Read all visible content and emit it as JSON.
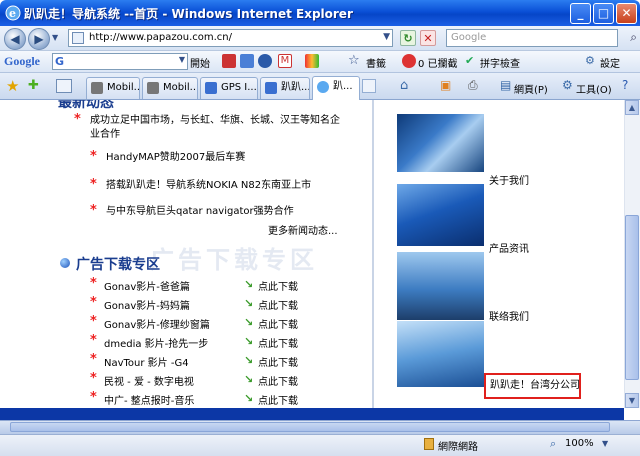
{
  "window": {
    "title": "趴趴走！导航系统 --首页 - Windows Internet Explorer",
    "minimize": "_",
    "maximize": "□",
    "close": "✕"
  },
  "address": {
    "url": "http://www.papazou.com.cn/",
    "search_placeholder": "Google"
  },
  "google_toolbar": {
    "logo": "Google",
    "g": "G",
    "start": "開始",
    "bookmarks": "書籤",
    "blocked": "0 已攔截",
    "spellcheck": "拼字檢查",
    "settings": "設定"
  },
  "tabs": [
    {
      "label": "Mobil..."
    },
    {
      "label": "Mobil..."
    },
    {
      "label": "GPS I..."
    },
    {
      "label": "趴趴..."
    },
    {
      "label": "趴..."
    }
  ],
  "command_bar": {
    "page": "網頁(P)",
    "tools": "工具(O)"
  },
  "left": {
    "news_heading": "最新动态",
    "news": [
      {
        "text": "成功立足中国市场，与长虹、华旗、长城、汉王等知名企业合作"
      },
      {
        "text": "HandyMAP赞助2007最后车赛"
      },
      {
        "text": "搭载趴趴走！导航系统NOKIA N82东南亚上市"
      },
      {
        "text": "与中东导航巨头qatar navigator强势合作"
      }
    ],
    "more_news": "更多新闻动态...",
    "download_heading": "广告下载专区",
    "download_watermark": "广告下载专区",
    "downloads": [
      {
        "title": "Gonav影片-爸爸篇",
        "link": "点此下载"
      },
      {
        "title": "Gonav影片-妈妈篇",
        "link": "点此下载"
      },
      {
        "title": "Gonav影片-修理纱窗篇",
        "link": "点此下载"
      },
      {
        "title": "dmedia 影片-抢先一步",
        "link": "点此下载"
      },
      {
        "title": "NavTour 影片 -G4",
        "link": "点此下载"
      },
      {
        "title": "民视 - 爱 - 数字电视",
        "link": "点此下载"
      },
      {
        "title": "中广- 整点报时-音乐",
        "link": "点此下载"
      }
    ]
  },
  "right": {
    "links": [
      {
        "label": "关于我们"
      },
      {
        "label": "产品资讯"
      },
      {
        "label": "联络我们"
      }
    ],
    "taiwan_branch": "趴趴走！台湾分公司"
  },
  "status": {
    "zone": "網際網路",
    "zoom": "100%"
  },
  "colors": {
    "titlebar": "#0a4fd6",
    "heading": "#1a3d8f",
    "star": "#e22222",
    "highlight_box": "#e0201c",
    "blue_band": "#0c37a6"
  }
}
